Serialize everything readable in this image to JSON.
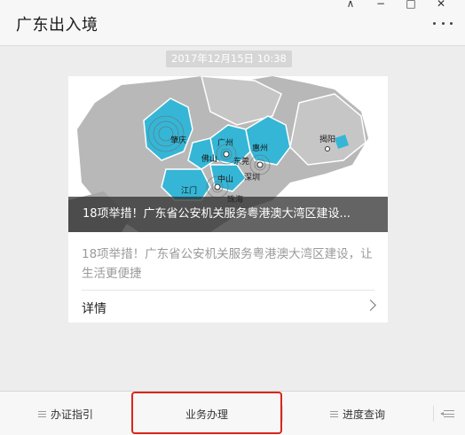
{
  "window_controls": {
    "pin": "⊼",
    "minimize": "−",
    "maximize": "□",
    "close": "✕"
  },
  "header": {
    "title": "广东出入境",
    "more_icon": "ellipsis-icon"
  },
  "message": {
    "timestamp": "2017年12月15日 10:38"
  },
  "article_card": {
    "cover_title": "18项举措！广东省公安机关服务粤港澳大湾区建设...",
    "digest": "18项举措！广东省公安机关服务粤港澳大湾区建设，让生活更便捷",
    "detail_label": "详情",
    "map_labels": {
      "zhaoqing": "肇庆",
      "guangzhou": "广州",
      "huizhou": "惠州",
      "jieyang": "揭阳",
      "foshan": "佛山",
      "dongguan": "东莞",
      "shenzhen": "深圳",
      "zhongshan": "中山",
      "jiangmen": "江门",
      "zhuhai": "珠海"
    },
    "colors": {
      "highlight_region": "#35b6d6",
      "base_region": "#b8b8b8"
    }
  },
  "bottom_menu": {
    "items": [
      {
        "label": "办证指引"
      },
      {
        "label": "业务办理"
      },
      {
        "label": "进度查询"
      }
    ],
    "highlight_color": "#d9261c",
    "keyboard_icon": "keyboard-switch-icon"
  }
}
